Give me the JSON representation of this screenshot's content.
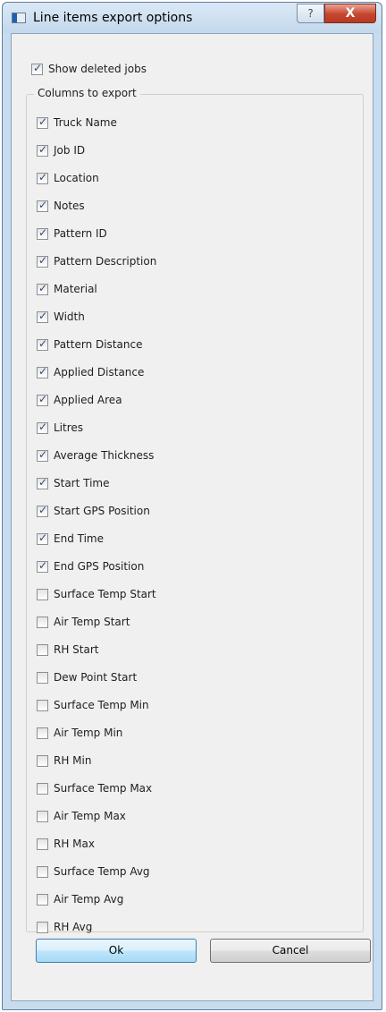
{
  "window": {
    "title": "Line items export options",
    "help_glyph": "?",
    "close_glyph": "X"
  },
  "show_deleted": {
    "label": "Show deleted jobs",
    "checked": true
  },
  "columns": {
    "legend": "Columns to export",
    "items": [
      {
        "label": "Truck Name",
        "checked": true
      },
      {
        "label": "Job ID",
        "checked": true
      },
      {
        "label": "Location",
        "checked": true
      },
      {
        "label": "Notes",
        "checked": true
      },
      {
        "label": "Pattern ID",
        "checked": true
      },
      {
        "label": "Pattern Description",
        "checked": true
      },
      {
        "label": "Material",
        "checked": true
      },
      {
        "label": "Width",
        "checked": true
      },
      {
        "label": "Pattern Distance",
        "checked": true
      },
      {
        "label": "Applied Distance",
        "checked": true
      },
      {
        "label": "Applied Area",
        "checked": true
      },
      {
        "label": "Litres",
        "checked": true
      },
      {
        "label": "Average Thickness",
        "checked": true
      },
      {
        "label": "Start Time",
        "checked": true
      },
      {
        "label": "Start GPS Position",
        "checked": true
      },
      {
        "label": "End Time",
        "checked": true
      },
      {
        "label": "End GPS Position",
        "checked": true
      },
      {
        "label": "Surface Temp Start",
        "checked": false
      },
      {
        "label": "Air Temp Start",
        "checked": false
      },
      {
        "label": "RH Start",
        "checked": false
      },
      {
        "label": "Dew Point Start",
        "checked": false
      },
      {
        "label": "Surface Temp Min",
        "checked": false
      },
      {
        "label": "Air Temp Min",
        "checked": false
      },
      {
        "label": "RH Min",
        "checked": false
      },
      {
        "label": "Surface Temp Max",
        "checked": false
      },
      {
        "label": "Air Temp Max",
        "checked": false
      },
      {
        "label": "RH Max",
        "checked": false
      },
      {
        "label": "Surface Temp Avg",
        "checked": false
      },
      {
        "label": "Air Temp Avg",
        "checked": false
      },
      {
        "label": "RH Avg",
        "checked": false
      }
    ]
  },
  "buttons": {
    "ok": "Ok",
    "cancel": "Cancel"
  }
}
